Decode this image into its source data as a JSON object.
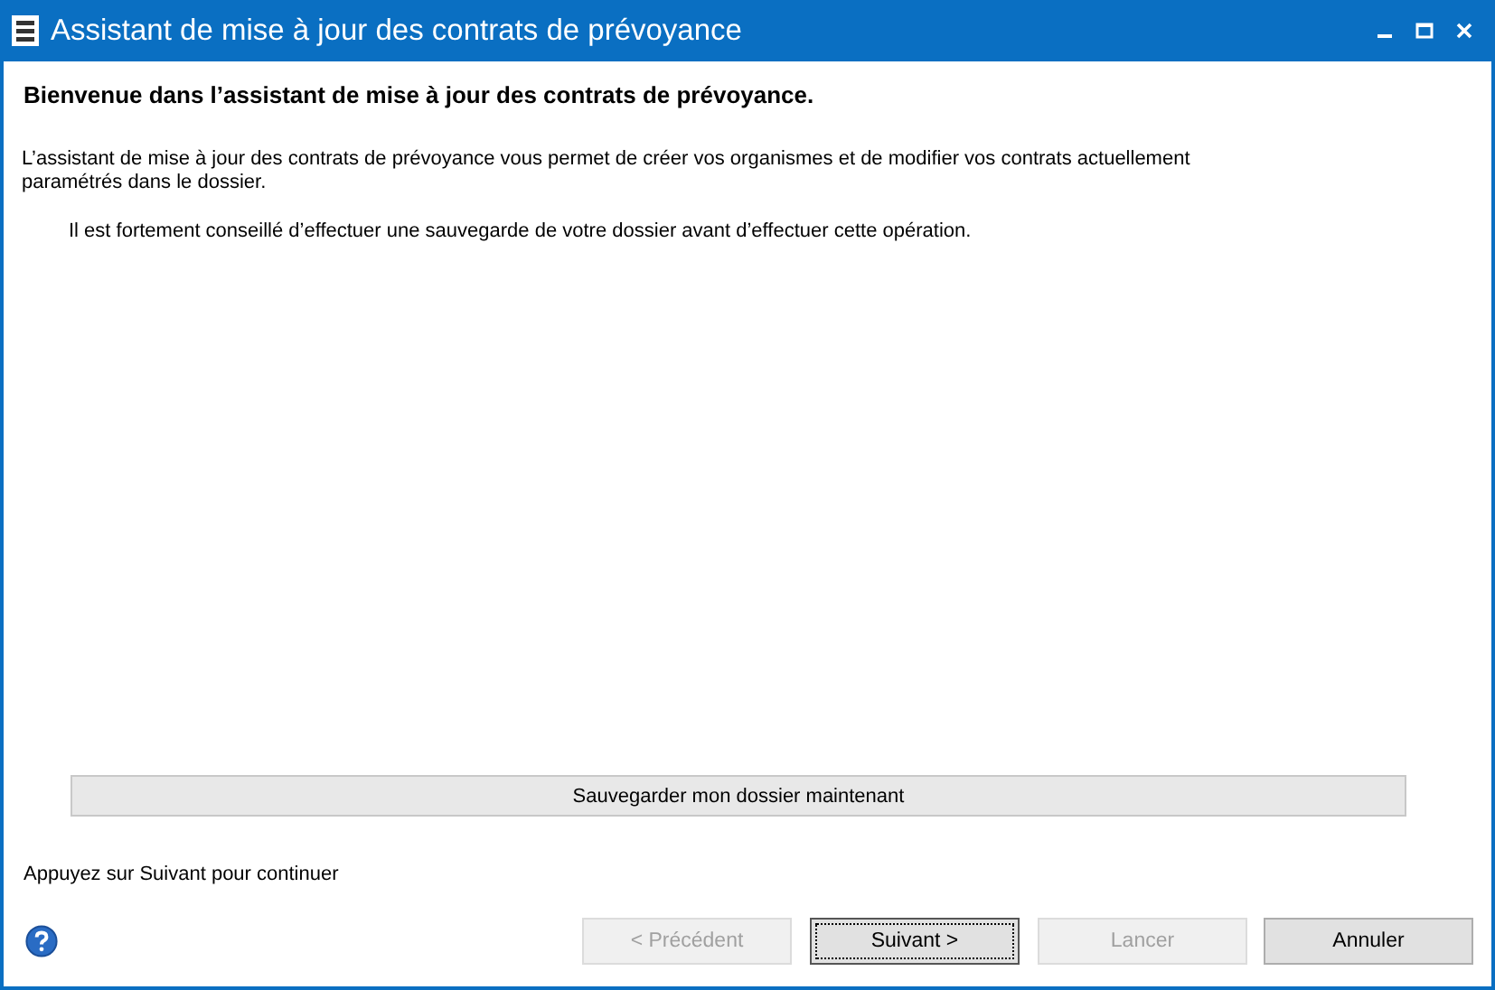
{
  "window": {
    "title": "Assistant de mise à jour des contrats de prévoyance"
  },
  "heading": "Bienvenue dans l’assistant de mise à jour des contrats de prévoyance.",
  "description": "L’assistant de mise à jour des contrats de prévoyance vous permet de créer vos organismes et de modifier vos contrats actuellement paramétrés dans le dossier.",
  "advice": "Il est fortement conseillé d’effectuer une sauvegarde de votre dossier avant d’effectuer cette opération.",
  "backup_button": "Sauvegarder mon dossier maintenant",
  "hint": "Appuyez sur Suivant pour continuer",
  "buttons": [
    {
      "label": "< Précédent",
      "disabled": true,
      "focused": false
    },
    {
      "label": "Suivant >",
      "disabled": false,
      "focused": true
    },
    {
      "label": "Lancer",
      "disabled": true,
      "focused": false
    },
    {
      "label": "Annuler",
      "disabled": false,
      "focused": false
    }
  ]
}
